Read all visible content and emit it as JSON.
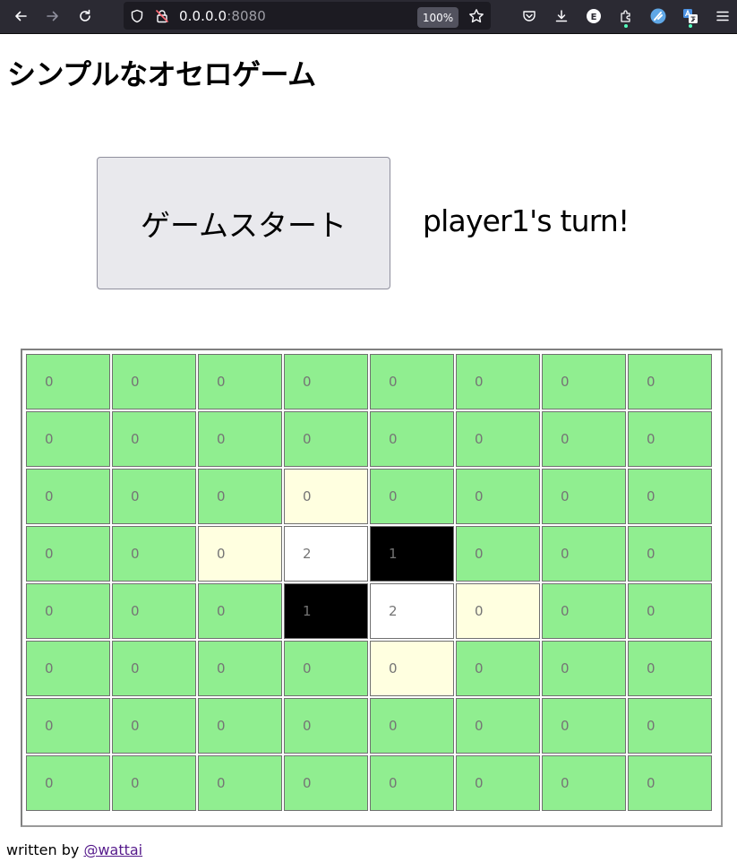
{
  "browser": {
    "url_host": "0.0.0.0",
    "url_port": ":8080",
    "zoom": "100%",
    "extension_badge": "E"
  },
  "page": {
    "title": "シンプルなオセロゲーム",
    "start_button_label": "ゲームスタート",
    "turn_status": "player1's turn!"
  },
  "board": {
    "rows": [
      [
        "0",
        "0",
        "0",
        "0",
        "0",
        "0",
        "0",
        "0"
      ],
      [
        "0",
        "0",
        "0",
        "0",
        "0",
        "0",
        "0",
        "0"
      ],
      [
        "0",
        "0",
        "0",
        "0",
        "0",
        "0",
        "0",
        "0"
      ],
      [
        "0",
        "0",
        "0",
        "2",
        "1",
        "0",
        "0",
        "0"
      ],
      [
        "0",
        "0",
        "0",
        "1",
        "2",
        "0",
        "0",
        "0"
      ],
      [
        "0",
        "0",
        "0",
        "0",
        "0",
        "0",
        "0",
        "0"
      ],
      [
        "0",
        "0",
        "0",
        "0",
        "0",
        "0",
        "0",
        "0"
      ],
      [
        "0",
        "0",
        "0",
        "0",
        "0",
        "0",
        "0",
        "0"
      ]
    ],
    "highlighted_cells": [
      [
        2,
        3
      ],
      [
        3,
        2
      ],
      [
        4,
        5
      ],
      [
        5,
        4
      ]
    ],
    "colors": {
      "empty": "#90ee90",
      "highlight": "#ffffe0",
      "player1": "#000000",
      "player2": "#ffffff",
      "cell_text": "#757575"
    }
  },
  "footer": {
    "prefix": "written by ",
    "link_text": "@wattai",
    "link_color": "#551a8b"
  }
}
